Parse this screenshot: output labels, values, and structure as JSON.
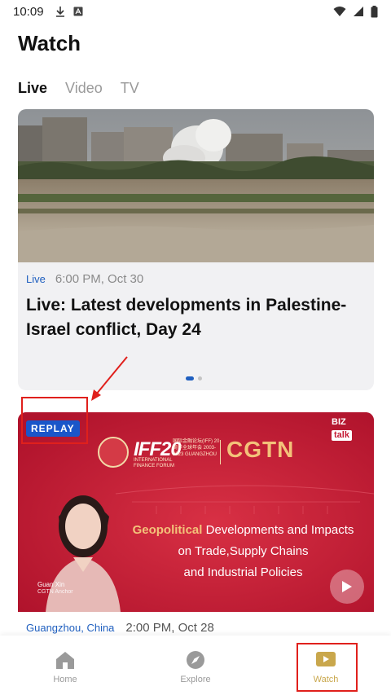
{
  "status_bar": {
    "time": "10:09"
  },
  "page": {
    "title": "Watch"
  },
  "tabs": [
    {
      "label": "Live",
      "active": true
    },
    {
      "label": "Video",
      "active": false
    },
    {
      "label": "TV",
      "active": false
    }
  ],
  "live_card": {
    "tag": "Live",
    "time": "6:00 PM, Oct 30",
    "title": "Live: Latest developments in Palestine-Israel conflict, Day 24",
    "carousel_pages": 2,
    "carousel_current": 1
  },
  "replay_card": {
    "badge": "REPLAY",
    "biz_top": "BIZ",
    "biz_bottom": "talk",
    "iff_logo": "IFF20",
    "iff_sub": "INTERNATIONAL FINANCE FORUM",
    "iff_right": "国际金融论坛(IFF) 20周年全球年会 2003-2023 GUANGZHOU",
    "cgtn": "CGTN",
    "headline_accent": "Geopolitical",
    "headline_rest": " Developments and Impacts",
    "headline_line2": "on Trade,Supply Chains",
    "headline_line3": "and Industrial Policies",
    "anchor_name": "Guan Xin",
    "anchor_role": "CGTN Anchor",
    "location": "Guangzhou, China",
    "time": "2:00 PM, Oct 28"
  },
  "bottom_nav": [
    {
      "label": "Home",
      "icon": "home-icon",
      "active": false
    },
    {
      "label": "Explore",
      "icon": "explore-icon",
      "active": false
    },
    {
      "label": "Watch",
      "icon": "watch-icon",
      "active": true
    }
  ],
  "colors": {
    "accent_blue": "#1f5fbf",
    "replay_red": "#c41a34",
    "watch_gold": "#c9a74c",
    "annotation_red": "#e0201c"
  }
}
